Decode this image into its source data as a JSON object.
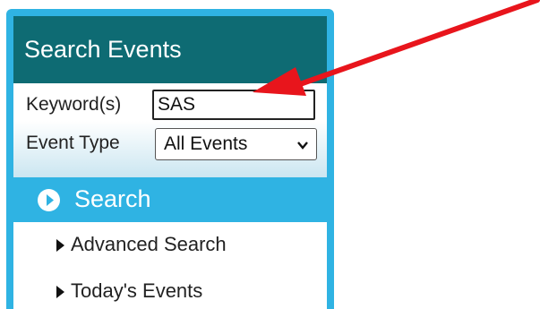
{
  "panel": {
    "title": "Search Events"
  },
  "form": {
    "keyword_label": "Keyword(s)",
    "keyword_value": "SAS",
    "event_type_label": "Event Type",
    "event_type_selected": "All Events"
  },
  "search": {
    "label": "Search",
    "icon": "play-circle-icon"
  },
  "links": {
    "advanced": "Advanced Search",
    "today": "Today's Events"
  },
  "annotation": {
    "icon": "red-arrow-icon",
    "color": "#e8151c"
  },
  "colors": {
    "header_bg": "#0e6b73",
    "accent": "#2fb3e3"
  }
}
